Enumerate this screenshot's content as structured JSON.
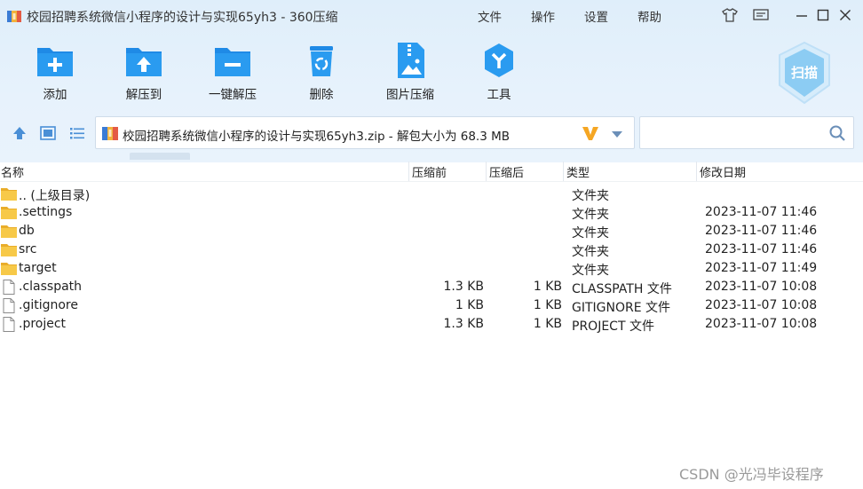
{
  "window": {
    "title": "校园招聘系统微信小程序的设计与实现65yh3 - 360压缩",
    "menu": [
      "文件",
      "操作",
      "设置",
      "帮助"
    ]
  },
  "toolbar": {
    "buttons": [
      {
        "label": "添加",
        "icon": "folder-add-icon"
      },
      {
        "label": "解压到",
        "icon": "folder-extract-icon"
      },
      {
        "label": "一键解压",
        "icon": "folder-oneclick-icon"
      },
      {
        "label": "删除",
        "icon": "recycle-bin-icon"
      },
      {
        "label": "图片压缩",
        "icon": "image-compress-icon"
      },
      {
        "label": "工具",
        "icon": "tools-icon"
      }
    ],
    "scan_label": "扫描"
  },
  "address": {
    "path": "校园招聘系统微信小程序的设计与实现65yh3.zip - 解包大小为 68.3 MB",
    "badge": "V"
  },
  "search": {
    "placeholder": ""
  },
  "columns": {
    "name": "名称",
    "size": "压缩前",
    "packed": "压缩后",
    "type": "类型",
    "modified": "修改日期"
  },
  "files": [
    {
      "kind": "folder",
      "name": ".. (上级目录)",
      "size": "",
      "packed": "",
      "type": "文件夹",
      "modified": ""
    },
    {
      "kind": "folder",
      "name": ".settings",
      "size": "",
      "packed": "",
      "type": "文件夹",
      "modified": "2023-11-07 11:46"
    },
    {
      "kind": "folder",
      "name": "db",
      "size": "",
      "packed": "",
      "type": "文件夹",
      "modified": "2023-11-07 11:46"
    },
    {
      "kind": "folder",
      "name": "src",
      "size": "",
      "packed": "",
      "type": "文件夹",
      "modified": "2023-11-07 11:46"
    },
    {
      "kind": "folder",
      "name": "target",
      "size": "",
      "packed": "",
      "type": "文件夹",
      "modified": "2023-11-07 11:49"
    },
    {
      "kind": "file",
      "name": ".classpath",
      "size": "1.3 KB",
      "packed": "1 KB",
      "type": "CLASSPATH 文件",
      "modified": "2023-11-07 10:08"
    },
    {
      "kind": "file",
      "name": ".gitignore",
      "size": "1 KB",
      "packed": "1 KB",
      "type": "GITIGNORE 文件",
      "modified": "2023-11-07 10:08"
    },
    {
      "kind": "file",
      "name": ".project",
      "size": "1.3 KB",
      "packed": "1 KB",
      "type": "PROJECT 文件",
      "modified": "2023-11-07 10:08"
    }
  ],
  "watermark": "CSDN @光冯毕设程序",
  "colors": {
    "accent": "#1e88e5",
    "icon_blue": "#1f8ae6",
    "folder": "#f5c242",
    "v_badge": "#f5a623"
  }
}
